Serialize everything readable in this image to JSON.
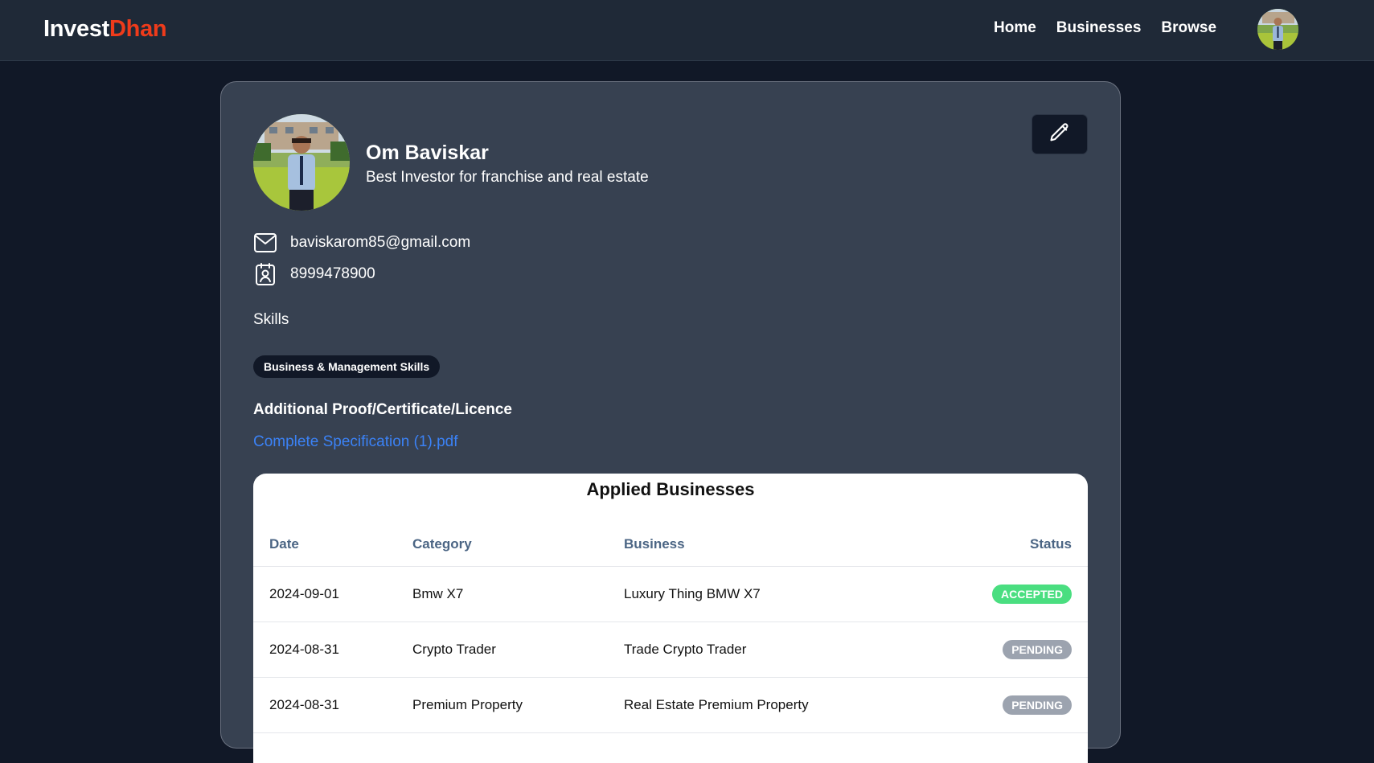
{
  "brand": {
    "part1": "Invest",
    "part2": "Dhan",
    "accent": "#ef3b1b"
  },
  "nav": {
    "links": [
      "Home",
      "Businesses",
      "Browse"
    ],
    "avatar_icon": "user-avatar"
  },
  "profile": {
    "name": "Om Baviskar",
    "tagline": "Best Investor for franchise and real estate",
    "email": "baviskarom85@gmail.com",
    "phone": "8999478900",
    "edit_icon": "pencil-icon",
    "skills_label": "Skills",
    "skills": [
      "Business & Management Skills"
    ],
    "proof_title": "Additional Proof/Certificate/Licence",
    "proof_file": "Complete Specification (1).pdf"
  },
  "applied": {
    "title": "Applied Businesses",
    "columns": [
      "Date",
      "Category",
      "Business",
      "Status"
    ],
    "rows": [
      {
        "date": "2024-09-01",
        "category": "Bmw X7",
        "business": "Luxury Thing BMW X7",
        "status": "ACCEPTED",
        "status_color": "#4ade80"
      },
      {
        "date": "2024-08-31",
        "category": "Crypto Trader",
        "business": "Trade Crypto Trader",
        "status": "PENDING",
        "status_color": "#9ca3af"
      },
      {
        "date": "2024-08-31",
        "category": "Premium Property",
        "business": "Real Estate Premium Property",
        "status": "PENDING",
        "status_color": "#9ca3af"
      }
    ]
  }
}
